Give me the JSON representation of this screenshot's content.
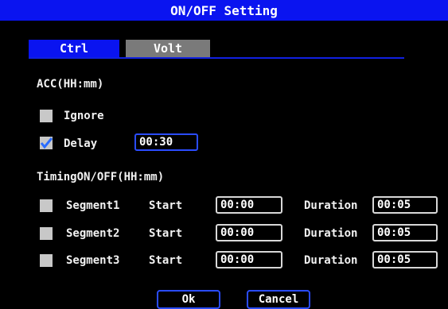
{
  "window": {
    "title": "ON/OFF Setting"
  },
  "tabs": [
    {
      "label": "Ctrl"
    },
    {
      "label": "Volt"
    }
  ],
  "acc": {
    "heading": "ACC(HH:mm)",
    "ignore": {
      "label": "Ignore",
      "checked": false
    },
    "delay": {
      "label": "Delay",
      "checked": true,
      "value": "00:30"
    }
  },
  "timing": {
    "heading": "TimingON/OFF(HH:mm)",
    "segments": [
      {
        "label": "Segment1",
        "start_label": "Start",
        "start": "00:00",
        "duration_label": "Duration",
        "duration": "00:05",
        "checked": false
      },
      {
        "label": "Segment2",
        "start_label": "Start",
        "start": "00:00",
        "duration_label": "Duration",
        "duration": "00:05",
        "checked": false
      },
      {
        "label": "Segment3",
        "start_label": "Start",
        "start": "00:00",
        "duration_label": "Duration",
        "duration": "00:05",
        "checked": false
      }
    ]
  },
  "buttons": {
    "ok": "Ok",
    "cancel": "Cancel"
  },
  "colors": {
    "title_bar": "#0a14f0",
    "active_tab": "#0a14f0",
    "inactive_tab": "#7a7a7a",
    "focus_border": "#2a4cff",
    "background": "#000000"
  }
}
